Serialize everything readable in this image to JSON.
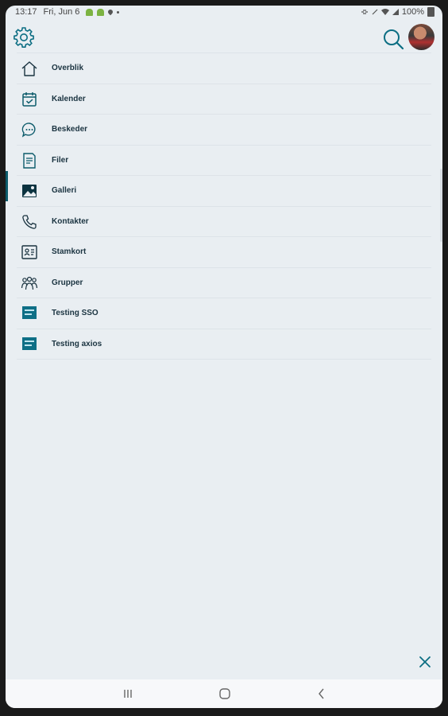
{
  "status": {
    "time": "13:17",
    "date": "Fri, Jun 6",
    "battery": "100%"
  },
  "colors": {
    "accent": "#0c6e83",
    "background": "#e9eef2",
    "text": "#1a3340"
  },
  "icons": {
    "settings": "gear-icon",
    "search": "search-icon",
    "close": "close-icon"
  },
  "menu": {
    "active_index": 4,
    "items": [
      {
        "label": "Overblik",
        "icon": "home-icon"
      },
      {
        "label": "Kalender",
        "icon": "calendar-icon"
      },
      {
        "label": "Beskeder",
        "icon": "chat-icon"
      },
      {
        "label": "Filer",
        "icon": "document-icon"
      },
      {
        "label": "Galleri",
        "icon": "image-icon"
      },
      {
        "label": "Kontakter",
        "icon": "phone-icon"
      },
      {
        "label": "Stamkort",
        "icon": "id-card-icon"
      },
      {
        "label": "Grupper",
        "icon": "group-icon"
      },
      {
        "label": "Testing SSO",
        "icon": "widget-icon"
      },
      {
        "label": "Testing axios",
        "icon": "widget-icon"
      }
    ]
  },
  "navbar": {
    "buttons": [
      "recent-apps-icon",
      "home-button-icon",
      "back-icon"
    ]
  }
}
